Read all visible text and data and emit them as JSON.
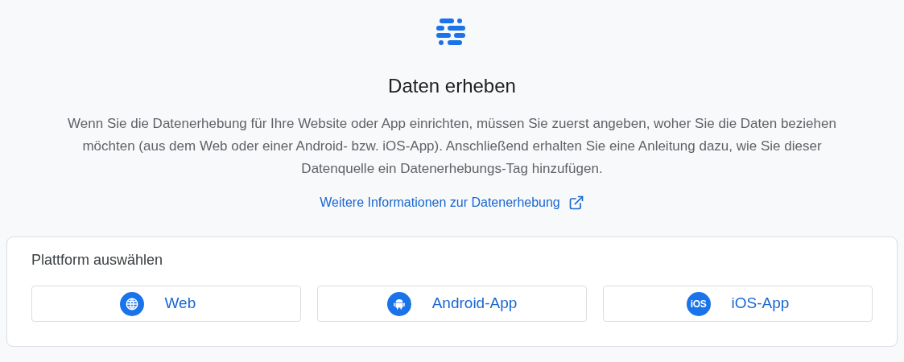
{
  "title": "Daten erheben",
  "description": "Wenn Sie die Datenerhebung für Ihre Website oder App einrichten, müssen Sie zuerst angeben, woher Sie die Daten beziehen möchten (aus dem Web oder einer Android- bzw. iOS-App). Anschließend erhalten Sie eine Anleitung dazu, wie Sie dieser Datenquelle ein Datenerhebungs-Tag hinzufügen.",
  "link": "Weitere Informationen zur Datenerhebung",
  "platform_card": {
    "heading": "Plattform auswählen",
    "buttons": [
      {
        "kind": "web",
        "label": "Web"
      },
      {
        "kind": "android",
        "label": "Android-App"
      },
      {
        "kind": "ios",
        "label": "iOS-App",
        "icon_text": "iOS"
      }
    ]
  }
}
